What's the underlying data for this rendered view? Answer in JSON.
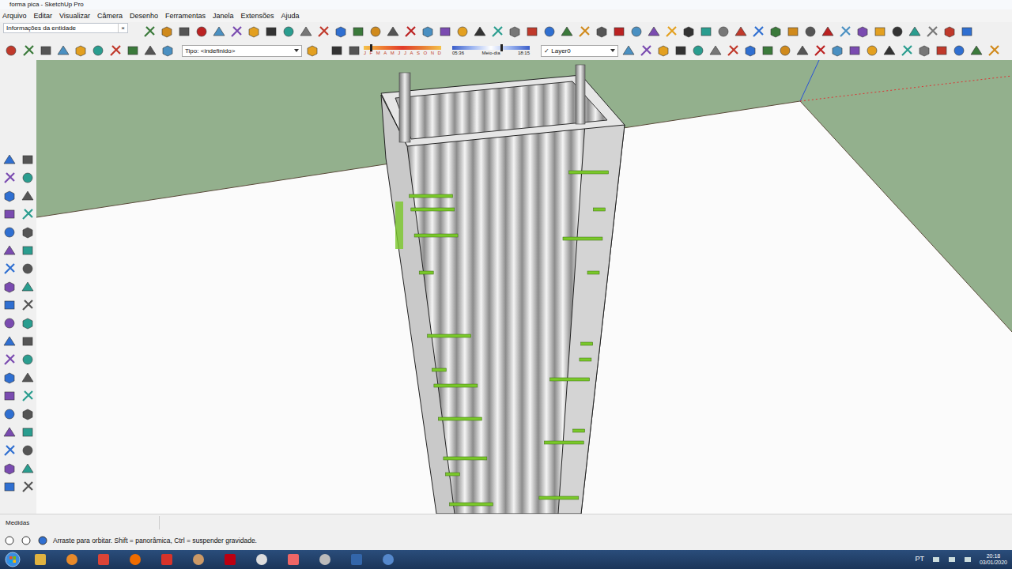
{
  "window": {
    "title": "forma pica - SketchUp Pro"
  },
  "menu": [
    "Arquivo",
    "Editar",
    "Visualizar",
    "Câmera",
    "Desenho",
    "Ferramentas",
    "Janela",
    "Extensões",
    "Ajuda"
  ],
  "entity_info": {
    "title": "Informações da entidade",
    "close": "×"
  },
  "style_toolbar": {
    "type_label": "Tipo: <indefinido>"
  },
  "shadows": {
    "months": [
      "J",
      "F",
      "M",
      "A",
      "M",
      "J",
      "J",
      "A",
      "S",
      "O",
      "N",
      "D"
    ],
    "date_level": 0.08,
    "start_time": "05:36",
    "noon": "Meio-dia",
    "end_time": "18:15",
    "time_level": 0.62
  },
  "layers": {
    "check": "✓",
    "current": "Layer0"
  },
  "measurements": {
    "label": "Medidas"
  },
  "status_bar": {
    "text": "Arraste para orbitar. Shift = panorâmica, Ctrl = suspender gravidade."
  },
  "taskbar": {
    "language": "PT",
    "time": "20:18",
    "date": "03/01/2020"
  }
}
